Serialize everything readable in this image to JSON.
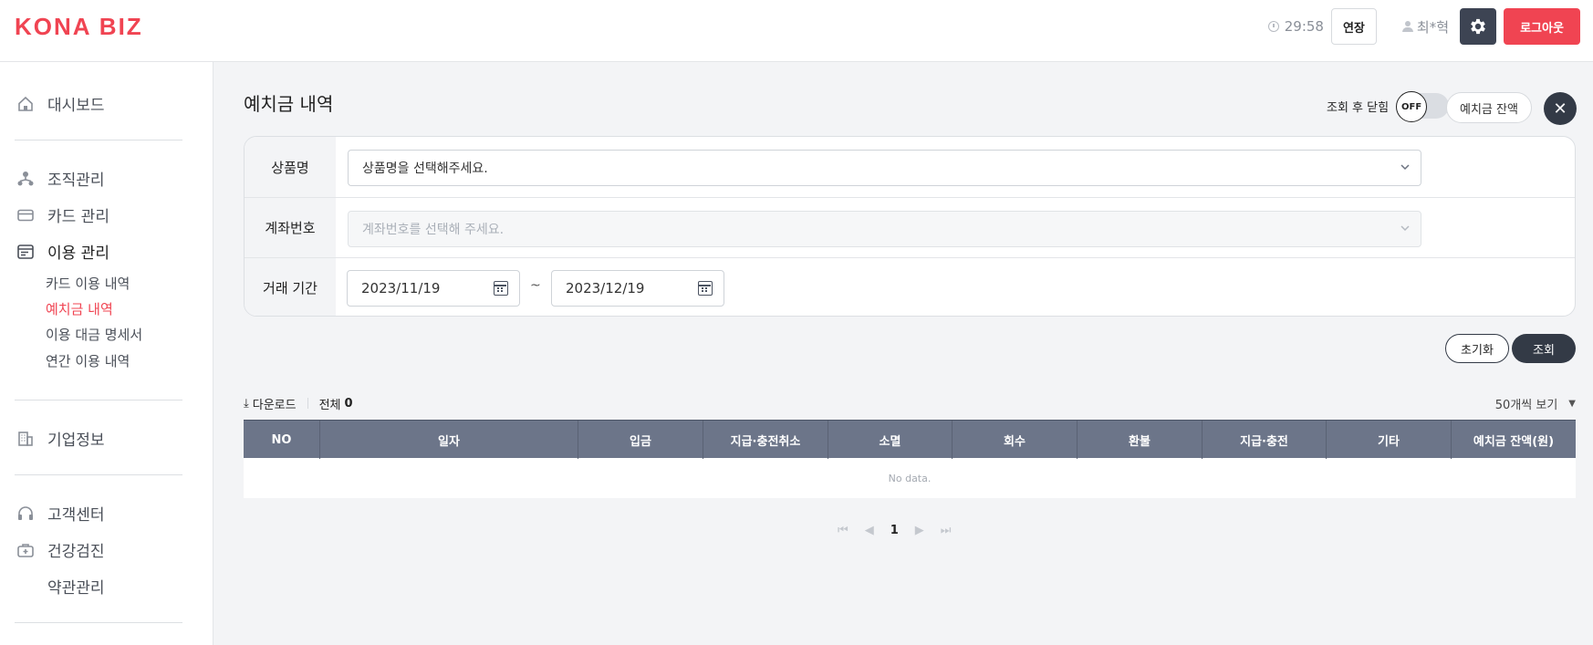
{
  "header": {
    "logo": "KONA BIZ",
    "timer": "29:58",
    "extend_label": "연장",
    "user_name": "최*혁",
    "logout_label": "로그아웃"
  },
  "sidebar": {
    "items": [
      {
        "label": "대시보드",
        "icon": "home-icon"
      },
      {
        "label": "조직관리",
        "icon": "org-chart-icon"
      },
      {
        "label": "카드 관리",
        "icon": "card-icon"
      },
      {
        "label": "이용 관리",
        "icon": "usage-icon"
      },
      {
        "label": "기업정보",
        "icon": "building-icon"
      },
      {
        "label": "고객센터",
        "icon": "headset-icon"
      },
      {
        "label": "건강검진",
        "icon": "medical-kit-icon"
      },
      {
        "label": "약관관리",
        "icon": ""
      }
    ],
    "sub_items": [
      "카드 이용 내역",
      "예치금 내역",
      "이용 대금 명세서",
      "연간 이용 내역"
    ]
  },
  "main": {
    "title": "예치금 내역",
    "close_after_search_label": "조회 후 닫힘",
    "toggle_state": "OFF",
    "balance_button": "예치금 잔액",
    "form": {
      "product_label": "상품명",
      "product_placeholder": "상품명을 선택해주세요.",
      "account_label": "계좌번호",
      "account_placeholder": "계좌번호를 선택해 주세요.",
      "period_label": "거래 기간",
      "date_from": "2023/11/19",
      "date_sep": "~",
      "date_to": "2023/12/19"
    },
    "reset_label": "초기화",
    "search_label": "조회",
    "toolbar": {
      "download_label": "다운로드",
      "total_label": "전체",
      "total_count": "0",
      "per_page": "50개씩 보기"
    },
    "table": {
      "columns": [
        "NO",
        "일자",
        "입금",
        "지급·충전취소",
        "소멸",
        "회수",
        "환불",
        "지급·충전",
        "기타",
        "예치금 잔액(원)"
      ],
      "empty_text": "No data."
    },
    "pagination": {
      "current_page": "1"
    }
  },
  "colors": {
    "brand": "#f04452",
    "dark": "#333a46",
    "table_header": "#6c7589"
  }
}
